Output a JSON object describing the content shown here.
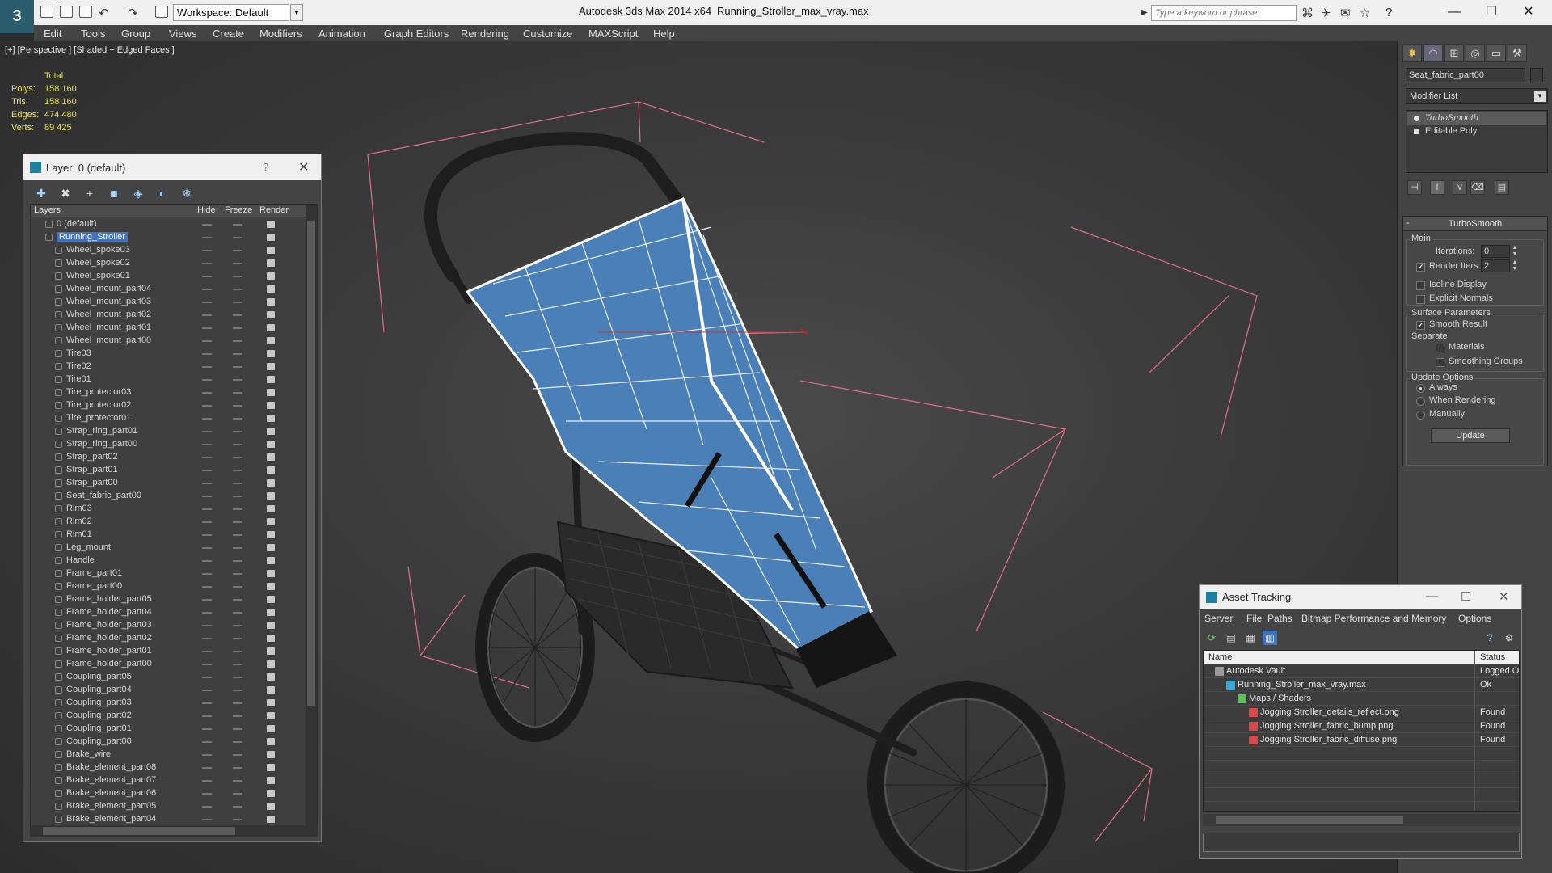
{
  "titlebar": {
    "workspace": "Workspace: Default",
    "app_title": "Autodesk 3ds Max  2014 x64",
    "file_title": "Running_Stroller_max_vray.max",
    "search_placeholder": "Type a keyword or phrase"
  },
  "menu": [
    "Edit",
    "Tools",
    "Group",
    "Views",
    "Create",
    "Modifiers",
    "Animation",
    "Graph Editors",
    "Rendering",
    "Customize",
    "MAXScript",
    "Help"
  ],
  "viewport": {
    "label": "[+] [Perspective ] [Shaded + Edged Faces ]",
    "stats_header": "Total",
    "stats": [
      {
        "label": "Polys:",
        "value": "158 160"
      },
      {
        "label": "Tris:",
        "value": "158 160"
      },
      {
        "label": "Edges:",
        "value": "474 480"
      },
      {
        "label": "Verts:",
        "value": "89 425"
      }
    ]
  },
  "layer_manager": {
    "title": "Layer: 0 (default)",
    "help": "?",
    "columns": {
      "layers": "Layers",
      "hide": "Hide",
      "freeze": "Freeze",
      "render": "Render"
    },
    "layers": [
      {
        "name": "0 (default)",
        "level": 1,
        "kind": "layer"
      },
      {
        "name": "Running_Stroller",
        "level": 1,
        "kind": "layer",
        "selected": true
      },
      {
        "name": "Wheel_spoke03",
        "level": 2,
        "kind": "object"
      },
      {
        "name": "Wheel_spoke02",
        "level": 2,
        "kind": "object"
      },
      {
        "name": "Wheel_spoke01",
        "level": 2,
        "kind": "object"
      },
      {
        "name": "Wheel_mount_part04",
        "level": 2,
        "kind": "object"
      },
      {
        "name": "Wheel_mount_part03",
        "level": 2,
        "kind": "object"
      },
      {
        "name": "Wheel_mount_part02",
        "level": 2,
        "kind": "object"
      },
      {
        "name": "Wheel_mount_part01",
        "level": 2,
        "kind": "object"
      },
      {
        "name": "Wheel_mount_part00",
        "level": 2,
        "kind": "object"
      },
      {
        "name": "Tire03",
        "level": 2,
        "kind": "object"
      },
      {
        "name": "Tire02",
        "level": 2,
        "kind": "object"
      },
      {
        "name": "Tire01",
        "level": 2,
        "kind": "object"
      },
      {
        "name": "Tire_protector03",
        "level": 2,
        "kind": "object"
      },
      {
        "name": "Tire_protector02",
        "level": 2,
        "kind": "object"
      },
      {
        "name": "Tire_protector01",
        "level": 2,
        "kind": "object"
      },
      {
        "name": "Strap_ring_part01",
        "level": 2,
        "kind": "object"
      },
      {
        "name": "Strap_ring_part00",
        "level": 2,
        "kind": "object"
      },
      {
        "name": "Strap_part02",
        "level": 2,
        "kind": "object"
      },
      {
        "name": "Strap_part01",
        "level": 2,
        "kind": "object"
      },
      {
        "name": "Strap_part00",
        "level": 2,
        "kind": "object"
      },
      {
        "name": "Seat_fabric_part00",
        "level": 2,
        "kind": "object"
      },
      {
        "name": "Rim03",
        "level": 2,
        "kind": "object"
      },
      {
        "name": "Rim02",
        "level": 2,
        "kind": "object"
      },
      {
        "name": "Rim01",
        "level": 2,
        "kind": "object"
      },
      {
        "name": "Leg_mount",
        "level": 2,
        "kind": "object"
      },
      {
        "name": "Handle",
        "level": 2,
        "kind": "object"
      },
      {
        "name": "Frame_part01",
        "level": 2,
        "kind": "object"
      },
      {
        "name": "Frame_part00",
        "level": 2,
        "kind": "object"
      },
      {
        "name": "Frame_holder_part05",
        "level": 2,
        "kind": "object"
      },
      {
        "name": "Frame_holder_part04",
        "level": 2,
        "kind": "object"
      },
      {
        "name": "Frame_holder_part03",
        "level": 2,
        "kind": "object"
      },
      {
        "name": "Frame_holder_part02",
        "level": 2,
        "kind": "object"
      },
      {
        "name": "Frame_holder_part01",
        "level": 2,
        "kind": "object"
      },
      {
        "name": "Frame_holder_part00",
        "level": 2,
        "kind": "object"
      },
      {
        "name": "Coupling_part05",
        "level": 2,
        "kind": "object"
      },
      {
        "name": "Coupling_part04",
        "level": 2,
        "kind": "object"
      },
      {
        "name": "Coupling_part03",
        "level": 2,
        "kind": "object"
      },
      {
        "name": "Coupling_part02",
        "level": 2,
        "kind": "object"
      },
      {
        "name": "Coupling_part01",
        "level": 2,
        "kind": "object"
      },
      {
        "name": "Coupling_part00",
        "level": 2,
        "kind": "object"
      },
      {
        "name": "Brake_wire",
        "level": 2,
        "kind": "object"
      },
      {
        "name": "Brake_element_part08",
        "level": 2,
        "kind": "object"
      },
      {
        "name": "Brake_element_part07",
        "level": 2,
        "kind": "object"
      },
      {
        "name": "Brake_element_part06",
        "level": 2,
        "kind": "object"
      },
      {
        "name": "Brake_element_part05",
        "level": 2,
        "kind": "object"
      },
      {
        "name": "Brake_element_part04",
        "level": 2,
        "kind": "object"
      }
    ]
  },
  "command_panel": {
    "object_name": "Seat_fabric_part00",
    "modifier_list": "Modifier List",
    "stack": [
      "TurboSmooth",
      "Editable Poly"
    ],
    "turbosmooth": {
      "title": "TurboSmooth",
      "main_group": "Main",
      "iterations_label": "Iterations:",
      "iterations_value": "0",
      "render_iters_label": "Render Iters:",
      "render_iters_value": "2",
      "render_iters_checked": true,
      "isoline_label": "Isoline Display",
      "explicit_normals_label": "Explicit Normals",
      "surface_group": "Surface Parameters",
      "smooth_result_label": "Smooth Result",
      "separate_label": "Separate",
      "materials_label": "Materials",
      "smoothing_groups_label": "Smoothing Groups",
      "update_group": "Update Options",
      "always_label": "Always",
      "when_rendering_label": "When Rendering",
      "manually_label": "Manually",
      "update_button": "Update"
    }
  },
  "asset_tracking": {
    "title": "Asset Tracking",
    "menu": [
      "Server",
      "File",
      "Paths",
      "Bitmap Performance and Memory",
      "Options"
    ],
    "columns": {
      "name": "Name",
      "status": "Status"
    },
    "rows": [
      {
        "name": "Autodesk Vault",
        "status": "Logged O",
        "level": 1,
        "icon": "vault"
      },
      {
        "name": "Running_Stroller_max_vray.max",
        "status": "Ok",
        "level": 2,
        "icon": "max-file"
      },
      {
        "name": "Maps / Shaders",
        "status": "",
        "level": 3,
        "icon": "maps"
      },
      {
        "name": "Jogging Stroller_details_reflect.png",
        "status": "Found",
        "level": 4,
        "icon": "png"
      },
      {
        "name": "Jogging Stroller_fabric_bump.png",
        "status": "Found",
        "level": 4,
        "icon": "png"
      },
      {
        "name": "Jogging Stroller_fabric_diffuse.png",
        "status": "Found",
        "level": 4,
        "icon": "png"
      }
    ]
  },
  "colors": {
    "seat_fabric": "#4a7fb8",
    "selection": "#3f73c0",
    "stats_text": "#e6e060",
    "bbox_lines": "#e0708a"
  }
}
